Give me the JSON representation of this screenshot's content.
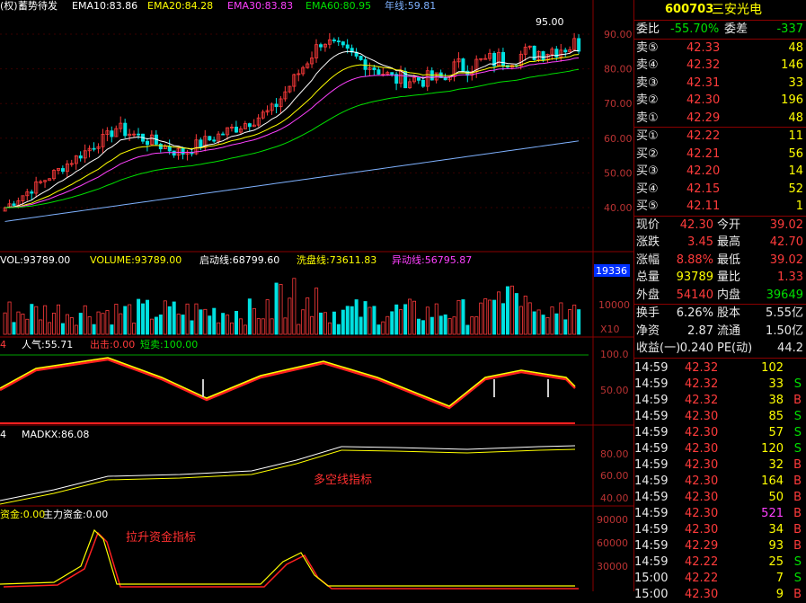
{
  "chart": {
    "header": {
      "prefix": "(权)",
      "title": "蓄势待发",
      "ema10": "EMA10:83.86",
      "ema20": "EMA20:84.28",
      "ema30": "EMA30:83.83",
      "ema60": "EMA60:80.95",
      "year_line": "年线:59.81"
    },
    "price_axis": [
      "90.00",
      "80.00",
      "70.00",
      "60.00",
      "50.00",
      "40.00"
    ],
    "high_marker": "95.00",
    "vol_header": {
      "vol": "VOL:93789.00",
      "volume": "VOLUME:93789.00",
      "start_line": "启动线:68799.60",
      "wash_line": "洗盘线:73611.83",
      "abnormal_line": "异动线:56795.87"
    },
    "vol_axis": {
      "badge": "19336",
      "v1": "10000",
      "unit": "X10"
    },
    "popularity_header": {
      "prefix": "4",
      "popularity": "人气:55.71",
      "strike": "出击:0.00",
      "short_sell": "短卖:100.00"
    },
    "popularity_axis": [
      "100.0",
      "50.00"
    ],
    "madkx_header": {
      "prefix": "4",
      "madkx": "MADKX:86.08"
    },
    "madkx_axis": [
      "80.00",
      "60.00",
      "40.00"
    ],
    "madkx_note": "多空线指标",
    "fund_header": {
      "prefix": "资金:0.00",
      "main_fund": "主力资金:0.00"
    },
    "fund_axis": [
      "90000",
      "60000",
      "30000"
    ],
    "fund_note": "拉升资金指标",
    "signal_s": "S"
  },
  "quote": {
    "code": "600703",
    "name": "三安光电",
    "wei_bi_label": "委比",
    "wei_bi": "-55.70%",
    "wei_cha_label": "委差",
    "wei_cha": "-337",
    "asks": [
      {
        "label": "卖⑤",
        "price": "42.33",
        "vol": "48"
      },
      {
        "label": "卖④",
        "price": "42.32",
        "vol": "146"
      },
      {
        "label": "卖③",
        "price": "42.31",
        "vol": "33"
      },
      {
        "label": "卖②",
        "price": "42.30",
        "vol": "196"
      },
      {
        "label": "卖①",
        "price": "42.29",
        "vol": "48"
      }
    ],
    "bids": [
      {
        "label": "买①",
        "price": "42.22",
        "vol": "11"
      },
      {
        "label": "买②",
        "price": "42.21",
        "vol": "56"
      },
      {
        "label": "买③",
        "price": "42.20",
        "vol": "14"
      },
      {
        "label": "买④",
        "price": "42.15",
        "vol": "52"
      },
      {
        "label": "买⑤",
        "price": "42.11",
        "vol": "1"
      }
    ],
    "stats": [
      {
        "l1": "现价",
        "v1": "42.30",
        "l2": "今开",
        "v2": "39.02"
      },
      {
        "l1": "涨跌",
        "v1": "3.45",
        "l2": "最高",
        "v2": "42.70"
      },
      {
        "l1": "涨幅",
        "v1": "8.88%",
        "l2": "最低",
        "v2": "39.02"
      },
      {
        "l1": "总量",
        "v1": "93789",
        "l2": "量比",
        "v2": "1.33"
      },
      {
        "l1": "外盘",
        "v1": "54140",
        "l2": "内盘",
        "v2": "39649"
      }
    ],
    "stats2": [
      {
        "l1": "换手",
        "v1": "6.26%",
        "l2": "股本",
        "v2": "5.55亿"
      },
      {
        "l1": "净资",
        "v1": "2.87",
        "l2": "流通",
        "v2": "1.50亿"
      },
      {
        "l1": "收益(一)",
        "v1": "0.240",
        "l2": "PE(动)",
        "v2": "44.2"
      }
    ],
    "ticks": [
      {
        "t": "14:59",
        "p": "42.32",
        "v": "102",
        "d": ""
      },
      {
        "t": "14:59",
        "p": "42.32",
        "v": "33",
        "d": "S"
      },
      {
        "t": "14:59",
        "p": "42.32",
        "v": "38",
        "d": "B"
      },
      {
        "t": "14:59",
        "p": "42.30",
        "v": "85",
        "d": "S"
      },
      {
        "t": "14:59",
        "p": "42.30",
        "v": "57",
        "d": "S"
      },
      {
        "t": "14:59",
        "p": "42.30",
        "v": "120",
        "d": "S"
      },
      {
        "t": "14:59",
        "p": "42.30",
        "v": "32",
        "d": "B"
      },
      {
        "t": "14:59",
        "p": "42.30",
        "v": "164",
        "d": "B"
      },
      {
        "t": "14:59",
        "p": "42.30",
        "v": "50",
        "d": "B"
      },
      {
        "t": "14:59",
        "p": "42.30",
        "v": "521",
        "d": "B"
      },
      {
        "t": "14:59",
        "p": "42.30",
        "v": "34",
        "d": "B"
      },
      {
        "t": "14:59",
        "p": "42.29",
        "v": "93",
        "d": "B"
      },
      {
        "t": "14:59",
        "p": "42.22",
        "v": "25",
        "d": "S"
      },
      {
        "t": "15:00",
        "p": "42.22",
        "v": "7",
        "d": "S"
      },
      {
        "t": "15:00",
        "p": "42.30",
        "v": "9",
        "d": "B"
      }
    ]
  }
}
